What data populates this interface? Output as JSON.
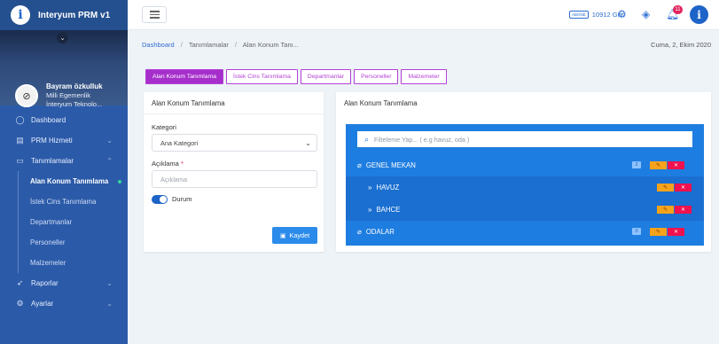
{
  "app": {
    "title": "Interyum PRM v1",
    "logo_letter": "i"
  },
  "profile": {
    "name": "Bayram özkulluk",
    "line1": "Milli Egemenlik",
    "line2": "İnteryum Teknolo..."
  },
  "sidebar": {
    "items": [
      {
        "label": "Dashboard",
        "icon": "circle-icon"
      },
      {
        "label": "PRM Hizmeti",
        "icon": "table-icon"
      },
      {
        "label": "Tanımlamalar",
        "icon": "calendar-icon"
      }
    ],
    "sub_items": [
      {
        "label": "Alan Konum Tanımlama"
      },
      {
        "label": "İstek Cins Tanımlama"
      },
      {
        "label": "Departmanlar"
      },
      {
        "label": "Personeller"
      },
      {
        "label": "Malzemeler"
      }
    ],
    "bottom_items": [
      {
        "label": "Raporlar",
        "icon": "rocket-icon"
      },
      {
        "label": "Ayarlar",
        "icon": "gear-icon"
      }
    ]
  },
  "topbar": {
    "days_badge": "ABONE",
    "days_text": "10912 Gün",
    "notifications": "11"
  },
  "breadcrumb": {
    "home": "Dashboard",
    "section": "Tanımlamalar",
    "current": "Alan Konum Tanı..."
  },
  "date": "Cuma, 2, Ekim 2020",
  "tabs": [
    {
      "label": "Alan Konum Tanımlama"
    },
    {
      "label": "İstek Cins Tanımlama"
    },
    {
      "label": "Departmanlar"
    },
    {
      "label": "Personeller"
    },
    {
      "label": "Malzemeler"
    }
  ],
  "form": {
    "title": "Alan Konum Tanımlama",
    "category_label": "Kategori",
    "category_value": "Ana Kategori",
    "description_label": "Açıklama",
    "description_required": "*",
    "description_placeholder": "Açıklama",
    "status_label": "Durum",
    "save_label": "Kaydet"
  },
  "tree": {
    "title": "Alan Konum Tanımlama",
    "filter_placeholder": "Filteleme Yap... ( e.g havuz, oda )",
    "rows": [
      {
        "label": "GENEL MEKAN",
        "count": "2"
      },
      {
        "label": "HAVUZ"
      },
      {
        "label": "BAHCE"
      },
      {
        "label": "ODALAR",
        "count": "0"
      }
    ]
  },
  "colors": {
    "sidebar": "#2b5aa8",
    "accent": "#1e64c8",
    "tab": "#a62fcb",
    "tree": "#1e7de0",
    "edit": "#f7a21b",
    "delete": "#f0114e"
  }
}
